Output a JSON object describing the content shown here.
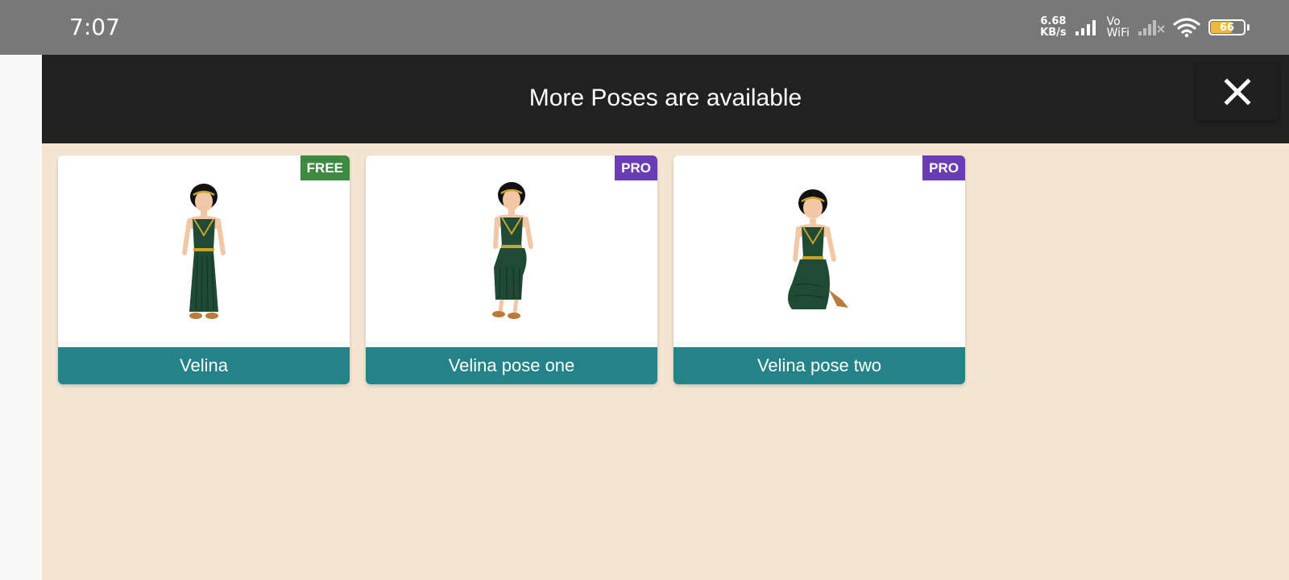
{
  "status_bar": {
    "time": "7:07",
    "net_speed_value": "6.68",
    "net_speed_unit": "KB/s",
    "vowifi_top": "Vo",
    "vowifi_bottom": "WiFi",
    "battery_level": "66",
    "battery_fraction": 0.66,
    "icons": [
      "signal-icon",
      "vowifi-icon",
      "no-signal-icon",
      "wifi-icon",
      "battery-icon"
    ]
  },
  "header": {
    "title": "More Poses are available",
    "close_icon": "close-icon"
  },
  "poses": [
    {
      "name": "Velina",
      "badge": "FREE",
      "badge_color": "#3d8b40",
      "pose": "standing"
    },
    {
      "name": "Velina pose one",
      "badge": "PRO",
      "badge_color": "#6a3db5",
      "pose": "sitting"
    },
    {
      "name": "Velina pose two",
      "badge": "PRO",
      "badge_color": "#6a3db5",
      "pose": "kneeling"
    }
  ],
  "colors": {
    "status_bar": "#787878",
    "header": "#212121",
    "content_bg": "#f3e5d0",
    "label_bg": "#248388"
  }
}
